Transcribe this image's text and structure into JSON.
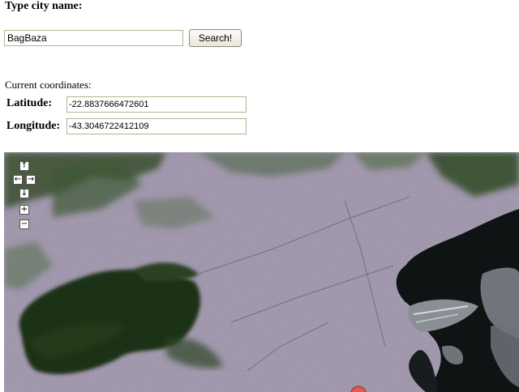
{
  "form": {
    "city_label": "Type city name:",
    "city_value": "BagBaza",
    "search_label": "Search!"
  },
  "coordinates": {
    "title": "Current coordinates:",
    "latitude_label": "Latitude:",
    "latitude_value": "-22.8837666472601",
    "longitude_label": "Longitude:",
    "longitude_value": "-43.3046722412109"
  },
  "map": {
    "view": "satellite",
    "controls": {
      "pan_up_icon": "↑",
      "pan_left_icon": "←",
      "pan_right_icon": "→",
      "pan_down_icon": "↓",
      "zoom_in_icon": "+",
      "zoom_out_icon": "−"
    },
    "colors": {
      "urban": "#9a8fa6",
      "vegetation": "#2f4a26",
      "water": "#0e1314",
      "marker": "#e85a4f"
    }
  }
}
